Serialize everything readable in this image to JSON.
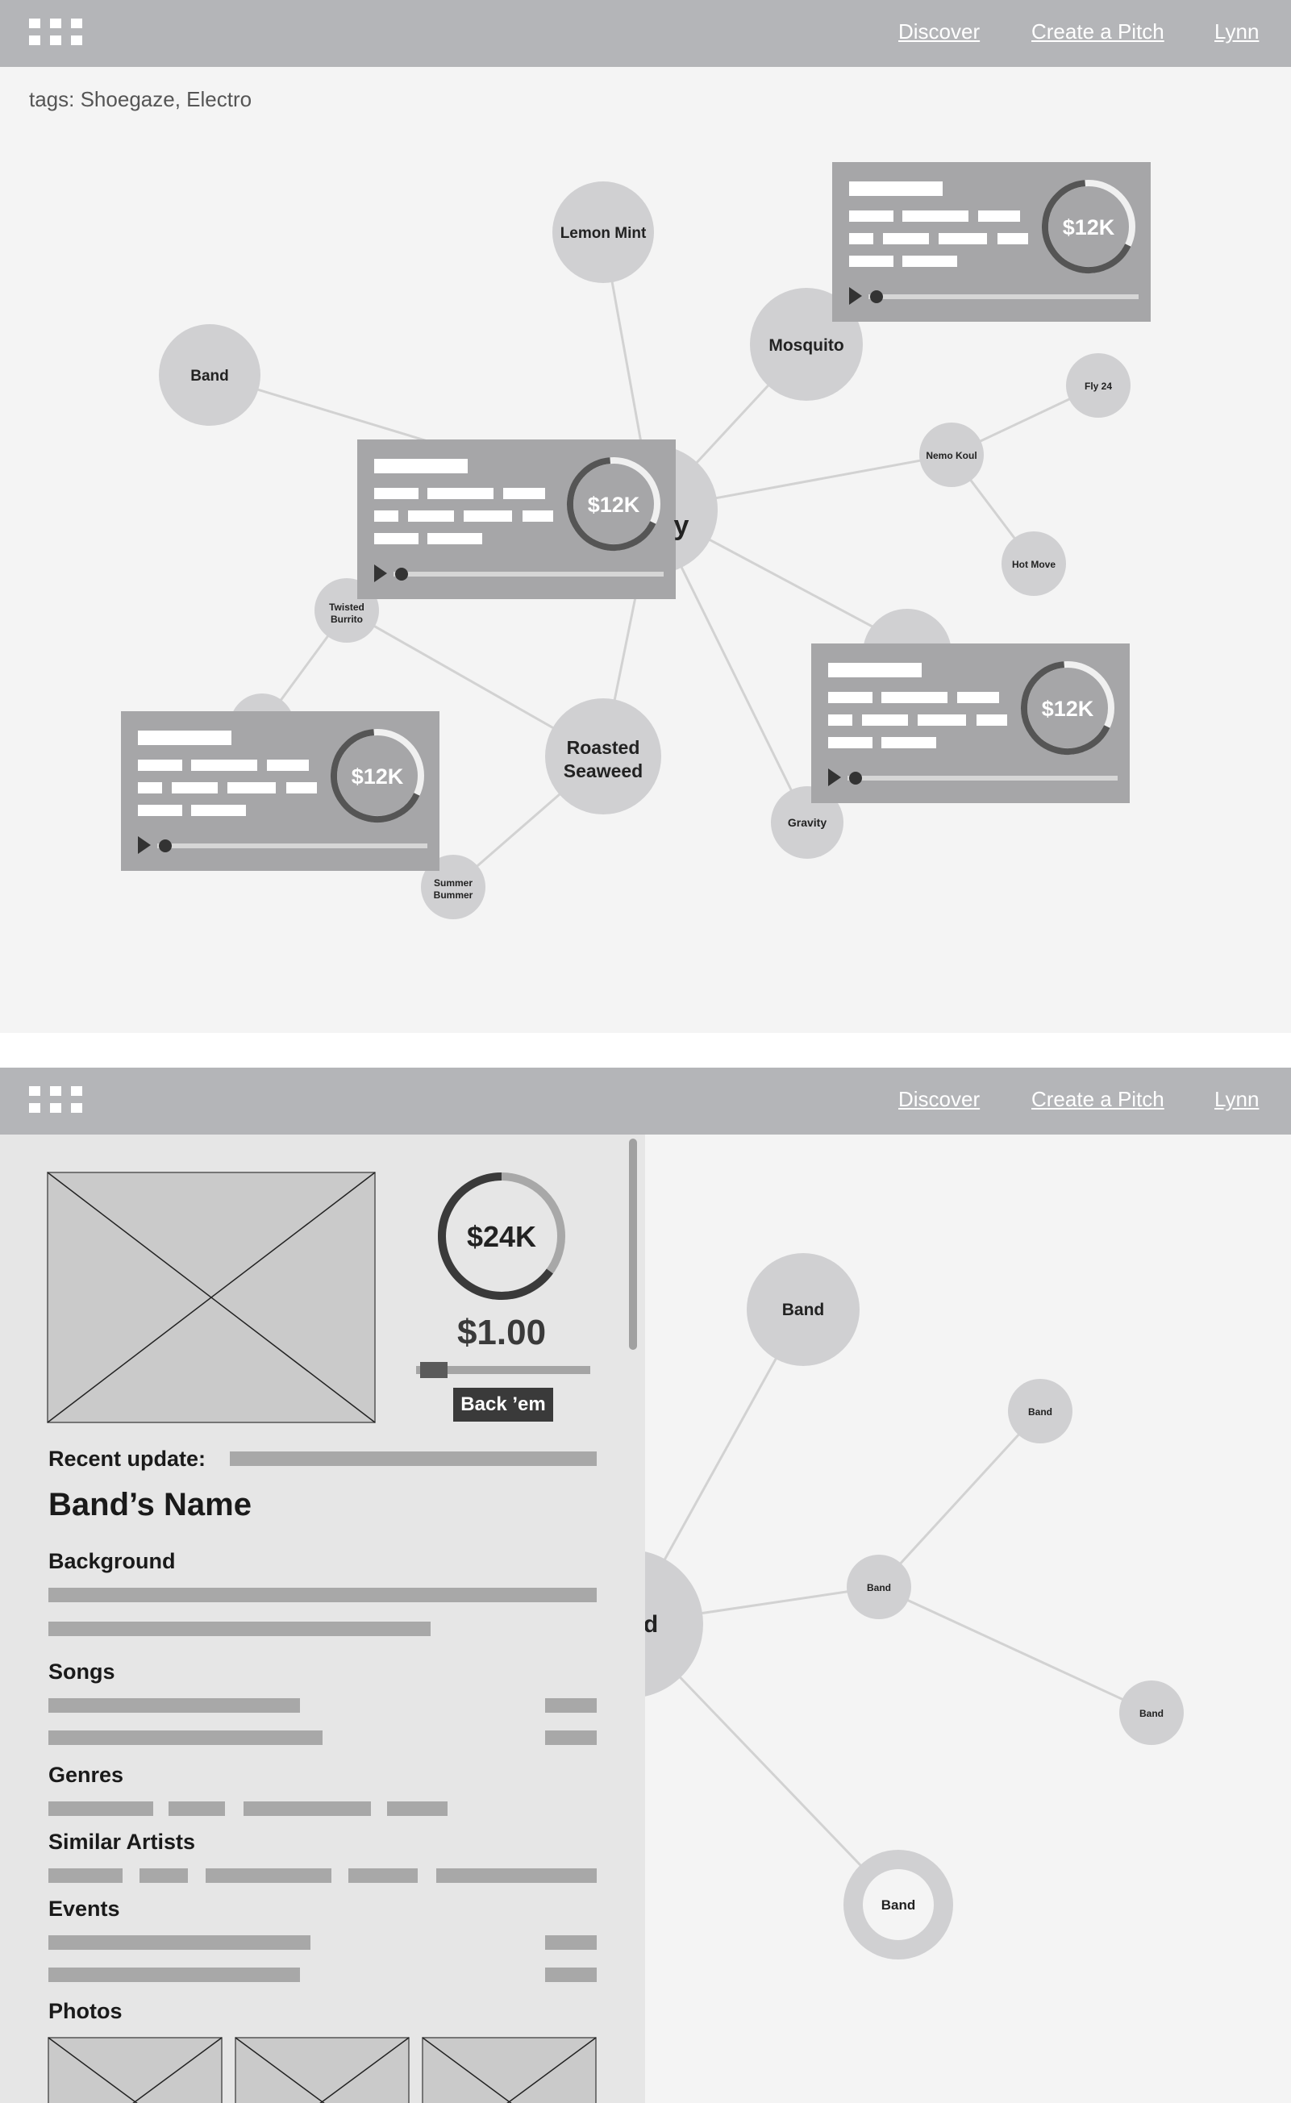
{
  "header": {
    "menu_icon": "grid-menu-icon",
    "nav": [
      "Discover",
      "Create a Pitch",
      "Lynn"
    ]
  },
  "screen1": {
    "tags": "tags: Shoegaze, Electro",
    "nodes": {
      "lemon_mint": "Lemon Mint",
      "band": "Band",
      "mosquito": "Mosquito",
      "fly24": "Fly 24",
      "nemo": "Nemo Koul",
      "hot_move": "Hot Move",
      "twisted": [
        "Twisted",
        "Burrito"
      ],
      "roasted": [
        "Roasted",
        "Seaweed"
      ],
      "gravity": "Gravity",
      "summer": [
        "Summer",
        "Bummer"
      ],
      "center_partial": "y"
    },
    "card_amount": "$12K",
    "card_progress": 0.8
  },
  "screen2": {
    "goal_amount": "$24K",
    "goal_progress": 0.65,
    "price": "$1.00",
    "back_button": "Back ’em",
    "recent_update": "Recent update:",
    "band_name": "Band’s Name",
    "sections": {
      "background": "Background",
      "songs": "Songs",
      "genres": "Genres",
      "similar": "Similar Artists",
      "events": "Events",
      "photos": "Photos"
    },
    "nodes": {
      "band": "Band",
      "center_partial": "d"
    }
  },
  "colors": {
    "topbar": "#b4b5b8",
    "canvas": "#f4f4f4",
    "node": "#d0d0d2",
    "card": "#a6a6a8",
    "dark": "#3a3a3a"
  }
}
